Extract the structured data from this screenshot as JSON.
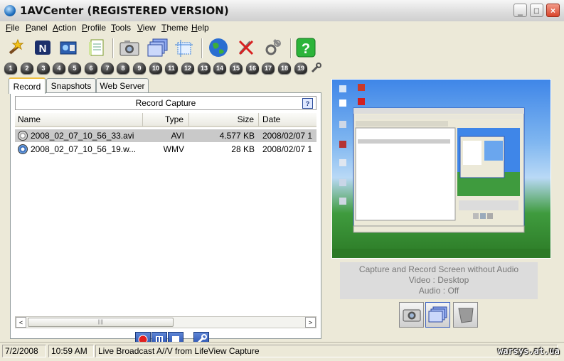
{
  "window": {
    "title": "1AVCenter (REGISTERED VERSION)",
    "min": "_",
    "max": "□",
    "close": "×"
  },
  "menu": [
    "File",
    "Panel",
    "Action",
    "Profile",
    "Tools",
    "View",
    "Theme",
    "Help"
  ],
  "menu_underline": [
    "F",
    "P",
    "A",
    "P",
    "T",
    "V",
    "T",
    "H"
  ],
  "toolbar_icons": [
    "wizard-icon",
    "netmeeting-icon",
    "record-video-icon",
    "notes-icon",
    "camera-icon",
    "screens-icon",
    "region-icon",
    "globe-icon",
    "no-tools-icon",
    "settings-icon",
    "help-icon"
  ],
  "panels": [
    "1",
    "2",
    "3",
    "4",
    "5",
    "6",
    "7",
    "8",
    "9",
    "10",
    "11",
    "12",
    "13",
    "14",
    "15",
    "16",
    "17",
    "18",
    "19"
  ],
  "tabs": [
    "Record",
    "Snapshots",
    "Web Server"
  ],
  "record": {
    "header": "Record Capture",
    "help": "?",
    "columns": [
      "Name",
      "Type",
      "Size",
      "Date"
    ],
    "rows": [
      {
        "name": "2008_02_07_10_56_33.avi",
        "type": "AVI",
        "size": "4.577 KB",
        "date": "2008/02/07 1"
      },
      {
        "name": "2008_02_07_10_56_19.w...",
        "type": "WMV",
        "size": "28 KB",
        "date": "2008/02/07 1"
      }
    ],
    "scroll_left": "<",
    "scroll_right": ">",
    "thumb_grip": "||||"
  },
  "right": {
    "info_line1": "Capture and Record Screen without Audio",
    "info_line2": "Video : Desktop",
    "info_line3": "Audio : Off"
  },
  "status": {
    "date": "7/2/2008",
    "time": "10:59 AM",
    "message": "Live Broadcast A//V from LifeView Capture"
  },
  "watermark": "warsys.at.ua",
  "colors": {
    "record_red": "#e02020",
    "selected_row": "#c9c9c9",
    "help_green": "#2cb43a"
  }
}
